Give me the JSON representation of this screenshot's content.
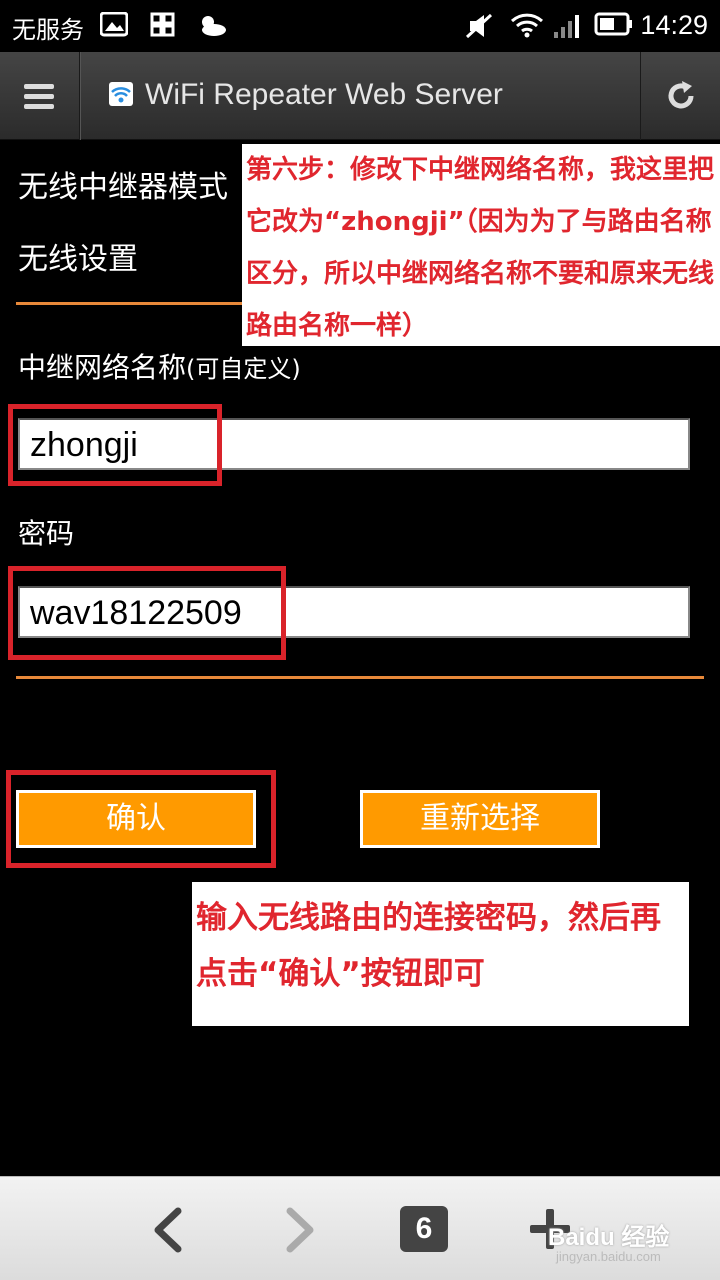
{
  "status_bar": {
    "carrier": "无服务",
    "time": "14:29"
  },
  "toolbar": {
    "title": "WiFi Repeater Web Server",
    "menu_icon": "menu-icon",
    "refresh_icon": "refresh-icon"
  },
  "page": {
    "mode_title": "无线中继器模式",
    "settings_title": "无线设置",
    "ssid_label": "中继网络名称",
    "ssid_hint": "(可自定义)",
    "ssid_value": "zhongji",
    "password_label": "密码",
    "password_value": "wav18122509",
    "confirm_label": "确认",
    "reselect_label": "重新选择"
  },
  "annotations": {
    "step6": "第六步：修改下中继网络名称，我这里把它改为“zhongji”（因为为了与路由名称区分，所以中继网络名称不要和原来无线路由名称一样）",
    "confirm_tip": "输入无线路由的连接密码，然后再点击“确认”按钮即可"
  },
  "bottom_bar": {
    "tab_count": "6",
    "watermark": "Baidu 经验",
    "watermark_url": "jingyan.baidu.com"
  },
  "colors": {
    "accent_orange": "#ff9a00",
    "divider_orange": "#e8893a",
    "highlight_red": "#d9232a",
    "annotation_red": "#e0262e"
  }
}
